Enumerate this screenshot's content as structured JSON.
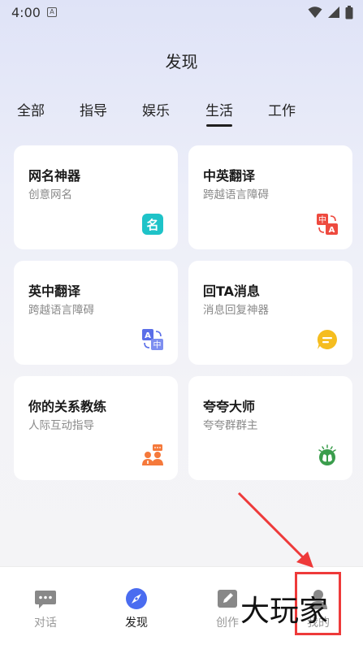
{
  "status_bar": {
    "time": "4:00",
    "notification_letter": "A"
  },
  "page_title": "发现",
  "tabs": [
    {
      "label": "全部"
    },
    {
      "label": "指导"
    },
    {
      "label": "娱乐"
    },
    {
      "label": "生活"
    },
    {
      "label": "工作"
    }
  ],
  "active_tab": "生活",
  "cards": [
    {
      "title": "网名神器",
      "subtitle": "创意网名",
      "icon": "name-badge-icon",
      "icon_text": "名",
      "color": "#1ec3c8"
    },
    {
      "title": "中英翻译",
      "subtitle": "跨越语言障碍",
      "icon": "translate-cn-en-icon",
      "icon_text_a": "中",
      "icon_text_b": "A",
      "color": "#ee4a3f"
    },
    {
      "title": "英中翻译",
      "subtitle": "跨越语言障碍",
      "icon": "translate-en-cn-icon",
      "icon_text_a": "A",
      "icon_text_b": "中",
      "color": "#5a6ee8"
    },
    {
      "title": "回TA消息",
      "subtitle": "消息回复神器",
      "icon": "reply-bubble-icon",
      "color": "#f5bd1f"
    },
    {
      "title": "你的关系教练",
      "subtitle": "人际互动指导",
      "icon": "people-coach-icon",
      "color": "#f5793b"
    },
    {
      "title": "夸夸大师",
      "subtitle": "夸夸群群主",
      "icon": "applause-icon",
      "color": "#3a9d4c"
    }
  ],
  "bottom_nav": [
    {
      "label": "对话",
      "icon": "chat-icon",
      "active": false
    },
    {
      "label": "发现",
      "icon": "compass-icon",
      "active": true
    },
    {
      "label": "创作",
      "icon": "pen-icon",
      "active": false
    },
    {
      "label": "我的",
      "icon": "person-icon",
      "active": false
    }
  ],
  "accent_color": "#4a6cf0",
  "watermark": "大玩家"
}
